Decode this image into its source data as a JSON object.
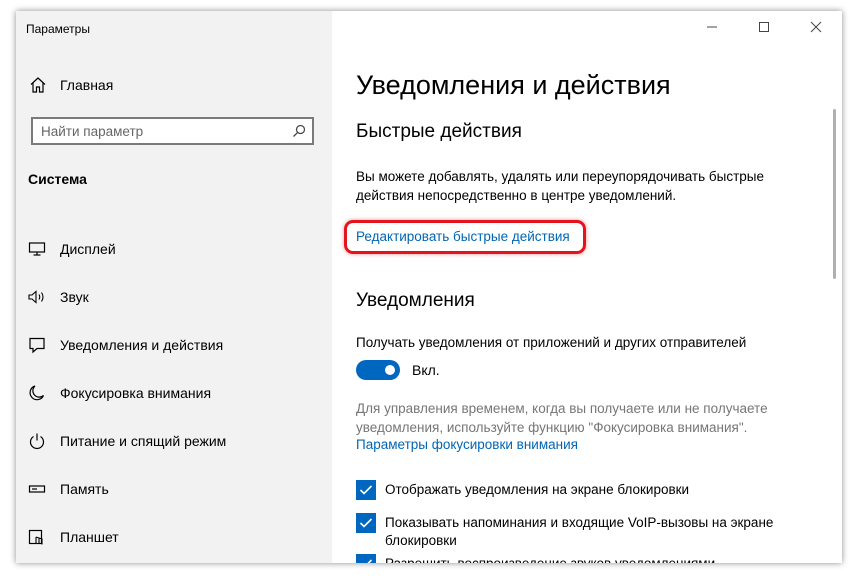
{
  "window": {
    "title": "Параметры"
  },
  "sidebar": {
    "home_label": "Главная",
    "search_placeholder": "Найти параметр",
    "section_title": "Система",
    "items": [
      {
        "label": "Дисплей",
        "icon": "display-icon"
      },
      {
        "label": "Звук",
        "icon": "speaker-icon"
      },
      {
        "label": "Уведомления и действия",
        "icon": "notification-icon"
      },
      {
        "label": "Фокусировка внимания",
        "icon": "moon-icon"
      },
      {
        "label": "Питание и спящий режим",
        "icon": "power-icon"
      },
      {
        "label": "Память",
        "icon": "storage-icon"
      },
      {
        "label": "Планшет",
        "icon": "tablet-icon"
      }
    ]
  },
  "main": {
    "title": "Уведомления и действия",
    "quick_actions": {
      "heading": "Быстрые действия",
      "description": "Вы можете добавлять, удалять или переупорядочивать быстрые действия непосредственно в центре уведомлений.",
      "edit_link": "Редактировать быстрые действия"
    },
    "notifications": {
      "heading": "Уведомления",
      "toggle_caption": "Получать уведомления от приложений и других отправителей",
      "toggle_state": "Вкл.",
      "toggle_on": true,
      "focus_hint": "Для управления временем, когда вы получаете или не получаете уведомления, используйте функцию \"Фокусировка внимания\".",
      "focus_link": "Параметры фокусировки внимания",
      "checkboxes": [
        {
          "label": "Отображать уведомления на экране блокировки",
          "checked": true
        },
        {
          "label": "Показывать напоминания и входящие VoIP-вызовы на экране блокировки",
          "checked": true
        },
        {
          "label": "Разрешить воспроизведение звуков уведомлениями",
          "checked": true
        }
      ]
    }
  },
  "colors": {
    "accent": "#0067c0",
    "link": "#0066b4",
    "highlight": "#e5131d",
    "sidebar_bg": "#f2f2f2"
  }
}
